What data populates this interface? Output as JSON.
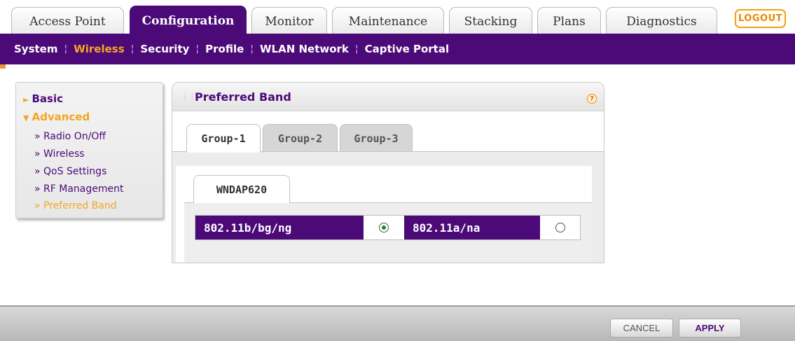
{
  "main_tabs": [
    {
      "label": "Access Point",
      "active": false
    },
    {
      "label": "Configuration",
      "active": true
    },
    {
      "label": "Monitor",
      "active": false
    },
    {
      "label": "Maintenance",
      "active": false
    },
    {
      "label": "Stacking",
      "active": false
    },
    {
      "label": "Plans",
      "active": false
    },
    {
      "label": "Diagnostics",
      "active": false
    }
  ],
  "logout_label": "LOGOUT",
  "sub_nav": [
    {
      "label": "System",
      "active": false
    },
    {
      "label": "Wireless",
      "active": true
    },
    {
      "label": "Security",
      "active": false
    },
    {
      "label": "Profile",
      "active": false
    },
    {
      "label": "WLAN Network",
      "active": false
    },
    {
      "label": "Captive Portal",
      "active": false
    }
  ],
  "left_menu": {
    "basic": "Basic",
    "advanced": "Advanced",
    "items": [
      {
        "label": "» Radio On/Off",
        "active": false
      },
      {
        "label": "» Wireless",
        "active": false
      },
      {
        "label": "» QoS Settings",
        "active": false
      },
      {
        "label": "» RF Management",
        "active": false
      },
      {
        "label": "» Preferred Band",
        "active": true
      }
    ]
  },
  "panel": {
    "title": "Preferred Band",
    "help": "?",
    "group_tabs": [
      {
        "label": "Group-1",
        "active": true
      },
      {
        "label": "Group-2",
        "active": false
      },
      {
        "label": "Group-3",
        "active": false
      }
    ],
    "device_tab": "WNDAP620",
    "bands": [
      {
        "label": "802.11b/bg/ng",
        "selected": true
      },
      {
        "label": "802.11a/na",
        "selected": false
      }
    ]
  },
  "buttons": {
    "cancel": "CANCEL",
    "apply": "APPLY"
  },
  "colors": {
    "brand_purple": "#4c0a78",
    "accent_orange": "#f5a623"
  }
}
